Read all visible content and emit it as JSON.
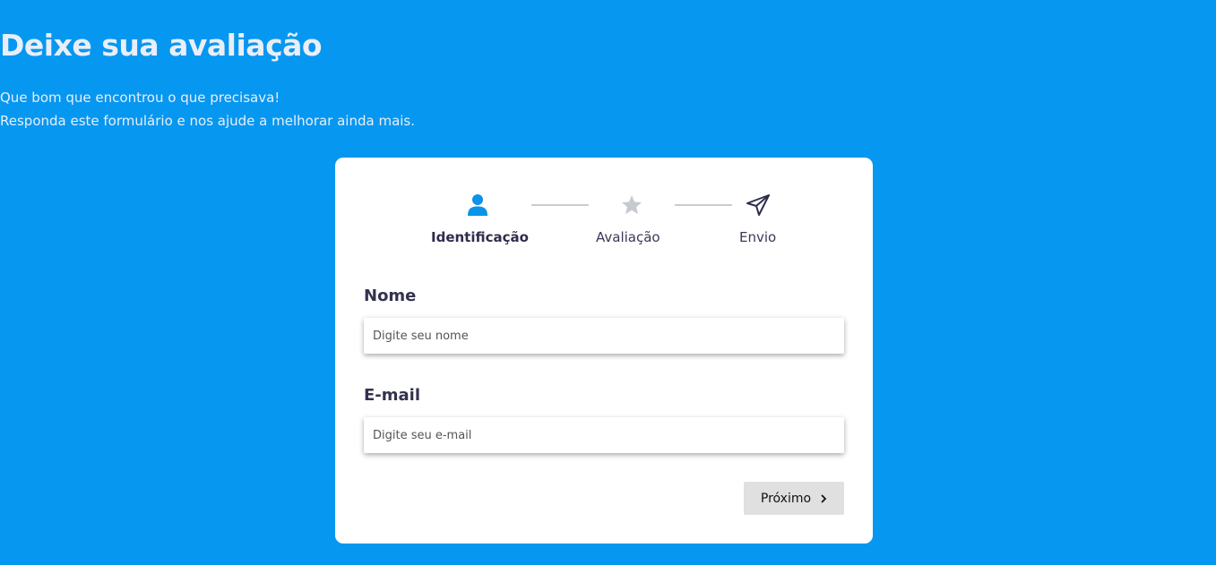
{
  "header": {
    "title": "Deixe sua avaliação",
    "subtitle_line1": "Que bom que encontrou o que precisava!",
    "subtitle_line2": "Responda este formulário e nos ajude a melhorar ainda mais."
  },
  "steps": [
    {
      "label": "Identificação",
      "icon": "user-icon",
      "state": "active"
    },
    {
      "label": "Avaliação",
      "icon": "star-icon",
      "state": "inactive"
    },
    {
      "label": "Envio",
      "icon": "send-icon",
      "state": "inactive"
    }
  ],
  "form": {
    "name_label": "Nome",
    "name_placeholder": "Digite seu nome",
    "name_value": "",
    "email_label": "E-mail",
    "email_placeholder": "Digite seu e-mail",
    "email_value": "",
    "next_label": "Próximo"
  },
  "colors": {
    "background": "#0697f1",
    "accent": "#0a93e8",
    "card": "#ffffff",
    "text_dark": "#33324f",
    "button_bg": "#e0e0e0"
  }
}
